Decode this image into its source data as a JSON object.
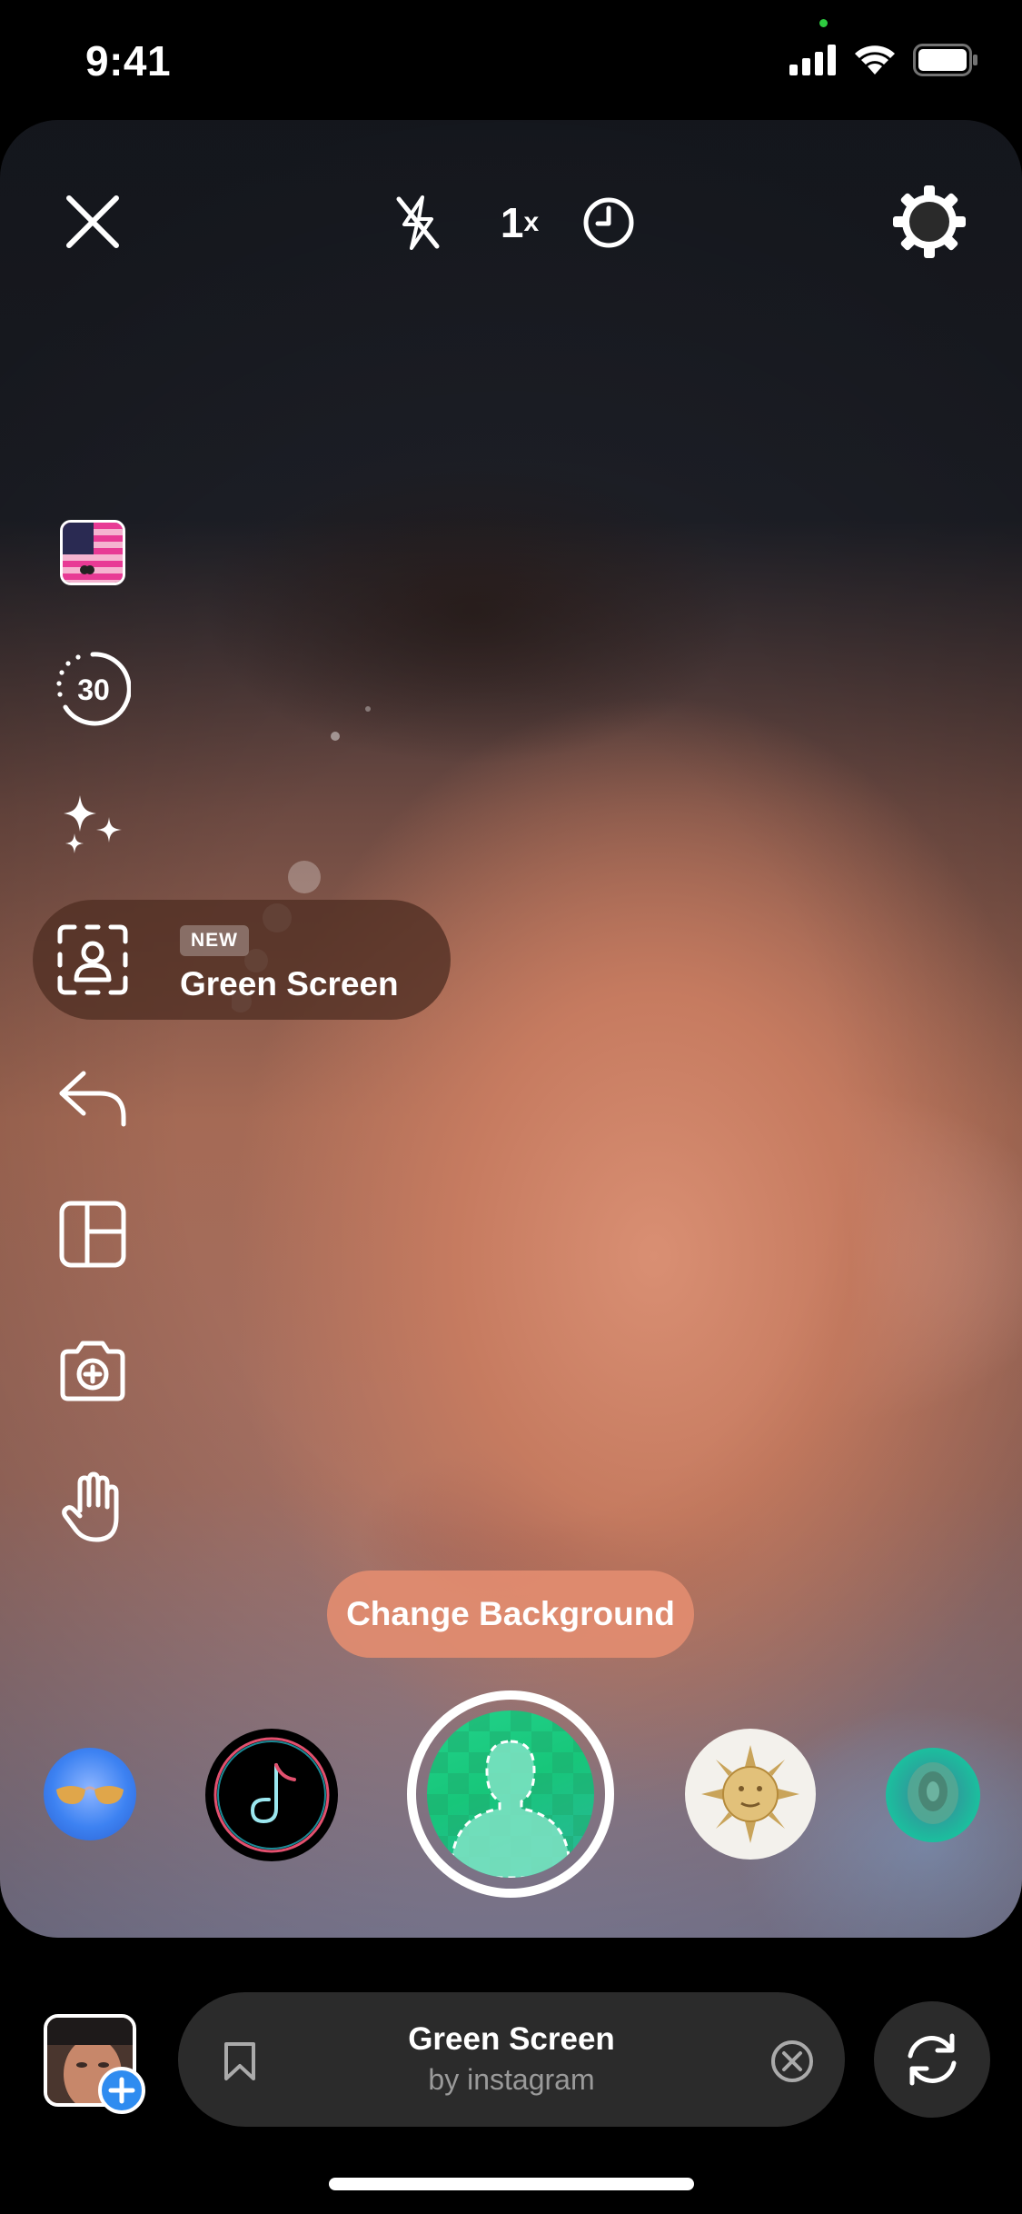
{
  "status_bar": {
    "time": "9:41",
    "icons": [
      "cellular-signal-icon",
      "wifi-icon",
      "battery-icon"
    ]
  },
  "top_controls": {
    "close_icon": "close-icon",
    "flash_icon": "flash-off-icon",
    "zoom_value": "1",
    "zoom_suffix": "x",
    "timer_icon": "clock-icon",
    "settings_icon": "gear-icon"
  },
  "left_rail": {
    "items": [
      {
        "name": "sticker-filter",
        "icon": "flag-icon"
      },
      {
        "name": "duration",
        "icon": "timer-30-icon",
        "label": "30"
      },
      {
        "name": "effects",
        "icon": "sparkles-icon"
      },
      {
        "name": "green-screen",
        "icon": "person-frame-icon"
      },
      {
        "name": "undo",
        "icon": "undo-arrow-icon"
      },
      {
        "name": "layout",
        "icon": "layout-grid-icon"
      },
      {
        "name": "dual-camera",
        "icon": "camera-plus-icon"
      },
      {
        "name": "hands-free",
        "icon": "hand-icon"
      }
    ],
    "active_effect": {
      "badge": "NEW",
      "label": "Green Screen"
    }
  },
  "hint_button": {
    "label": "Change Background"
  },
  "carousel": {
    "items": [
      {
        "name": "aviator-effect",
        "icon": "sunglasses-icon"
      },
      {
        "name": "music-effect",
        "icon": "music-note-icon"
      },
      {
        "name": "green-screen-effect",
        "icon": "person-silhouette-icon",
        "selected": true
      },
      {
        "name": "sun-effect",
        "icon": "sun-face-icon"
      },
      {
        "name": "aura-effect",
        "icon": "aura-icon"
      }
    ]
  },
  "bottom_bar": {
    "effect_title": "Green Screen",
    "effect_author": "by instagram",
    "bookmark_icon": "bookmark-icon",
    "clear_icon": "close-circle-icon",
    "flip_icon": "camera-flip-icon",
    "add_icon": "plus-icon"
  },
  "colors": {
    "accent_blue": "#2f8cf0",
    "pill_brown": "#502e22",
    "change_bg": "#e28c70",
    "green_screen": "#17c67a"
  }
}
